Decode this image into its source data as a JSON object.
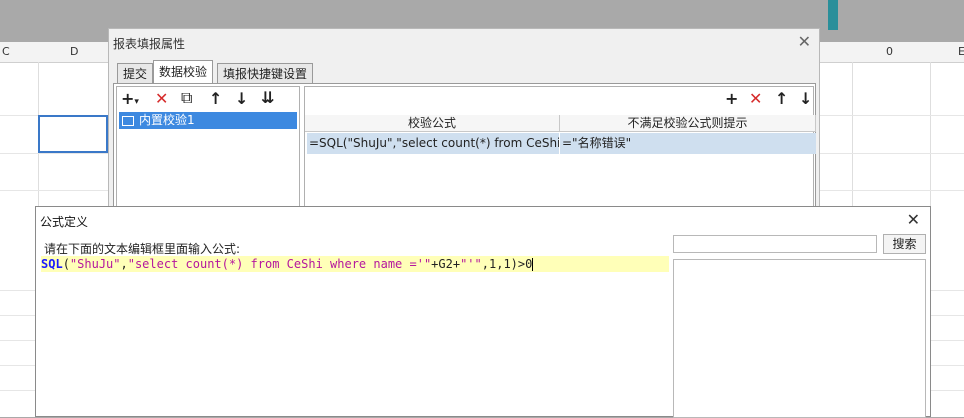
{
  "spreadsheet": {
    "left_col_headers": [
      "C",
      "D"
    ],
    "right_col_headers": [
      "0",
      "E"
    ]
  },
  "rule_dialog": {
    "title": "报表填报属性",
    "tabs": [
      {
        "label": "提交"
      },
      {
        "label": "数据校验",
        "active": true
      },
      {
        "label": "填报快捷键设置"
      }
    ],
    "left_toolbar": [
      "add-dropdown",
      "delete",
      "copy",
      "move-up",
      "move-down",
      "move-bottom"
    ],
    "rules": [
      {
        "name": "内置校验1",
        "selected": true
      }
    ],
    "right_toolbar": [
      "add",
      "delete",
      "move-up",
      "move-down"
    ],
    "columns": [
      "校验公式",
      "不满足校验公式则提示"
    ],
    "rows": [
      {
        "formula": "=SQL(\"ShuJu\",\"select count(*) from CeShi wh",
        "message": "=\"名称错误\""
      }
    ]
  },
  "formula_dialog": {
    "title": "公式定义",
    "prompt": "请在下面的文本编辑框里面输入公式:",
    "formula_tokens": {
      "fn": "SQL",
      "open": "(",
      "arg1": "\"ShuJu\"",
      "comma1": ",",
      "arg2": "\"select count(*) from CeShi where name ='\"",
      "plus1": "+G2+",
      "arg3": "\"'\"",
      "rest": ",1,1)>0"
    },
    "search_placeholder": "",
    "search_label": "搜索"
  }
}
